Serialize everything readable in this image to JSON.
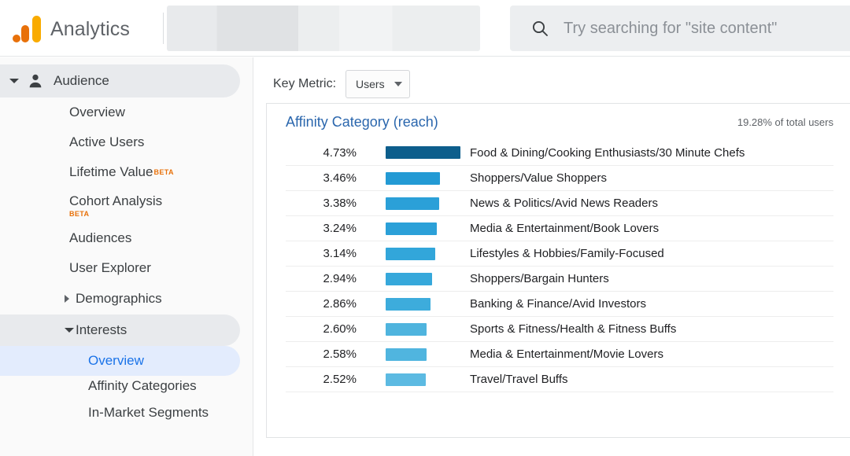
{
  "topbar": {
    "brand_title": "Analytics",
    "logo_icon": "google-analytics-logo",
    "search_icon": "search-icon",
    "search_placeholder": "Try searching for \"site content\"",
    "search_value": ""
  },
  "sidebar": {
    "section": {
      "label": "Audience",
      "icon": "person-icon",
      "caret_icon": "chevron-down-icon"
    },
    "items": [
      {
        "label": "Overview",
        "badge": ""
      },
      {
        "label": "Active Users",
        "badge": ""
      },
      {
        "label": "Lifetime Value",
        "badge": "BETA",
        "badge_position": "super"
      },
      {
        "label": "Cohort Analysis",
        "badge": "BETA",
        "badge_position": "below"
      },
      {
        "label": "Audiences",
        "badge": ""
      },
      {
        "label": "User Explorer",
        "badge": ""
      }
    ],
    "groups": [
      {
        "label": "Demographics",
        "expanded": false,
        "caret_icon": "chevron-right-icon"
      },
      {
        "label": "Interests",
        "expanded": true,
        "caret_icon": "chevron-down-icon"
      }
    ],
    "interests_children": [
      {
        "label": "Overview",
        "active": true
      },
      {
        "label": "Affinity Categories",
        "active": false
      },
      {
        "label": "In-Market Segments",
        "active": false
      }
    ]
  },
  "main": {
    "key_metric_label": "Key Metric:",
    "key_metric_value": "Users",
    "key_metric_caret_icon": "chevron-down-icon",
    "card_title": "Affinity Category (reach)",
    "card_subtext": "19.28% of total users"
  },
  "colors": {
    "brand_orange": "#e8710a",
    "brand_yellow": "#f9ab00",
    "link_blue": "#2a66ad",
    "active_blue": "#1a73e8",
    "bar_dark": "#0d5e8c",
    "bar_light": "#61b9e0"
  },
  "chart_data": {
    "type": "bar",
    "title": "Affinity Category (reach)",
    "subtitle": "19.28% of total users",
    "xlabel": "",
    "ylabel": "",
    "metric": "Users",
    "value_suffix": "%",
    "orientation": "horizontal",
    "grid": false,
    "legend": "none",
    "xlim": [
      0,
      4.73
    ],
    "categories": [
      "Food & Dining/Cooking Enthusiasts/30 Minute Chefs",
      "Shoppers/Value Shoppers",
      "News & Politics/Avid News Readers",
      "Media & Entertainment/Book Lovers",
      "Lifestyles & Hobbies/Family-Focused",
      "Shoppers/Bargain Hunters",
      "Banking & Finance/Avid Investors",
      "Sports & Fitness/Health & Fitness Buffs",
      "Media & Entertainment/Movie Lovers",
      "Travel/Travel Buffs"
    ],
    "values": [
      4.73,
      3.46,
      3.38,
      3.24,
      3.14,
      2.94,
      2.86,
      2.6,
      2.58,
      2.52
    ],
    "labels": [
      "4.73%",
      "3.46%",
      "3.38%",
      "3.24%",
      "3.14%",
      "2.94%",
      "2.86%",
      "2.60%",
      "2.58%",
      "2.52%"
    ],
    "bar_colors": [
      "#0d5e8c",
      "#239ad4",
      "#2ba0d8",
      "#2ba0d8",
      "#32a6da",
      "#36a8db",
      "#3dacdc",
      "#4fb4de",
      "#50b5df",
      "#5cbae2"
    ]
  }
}
